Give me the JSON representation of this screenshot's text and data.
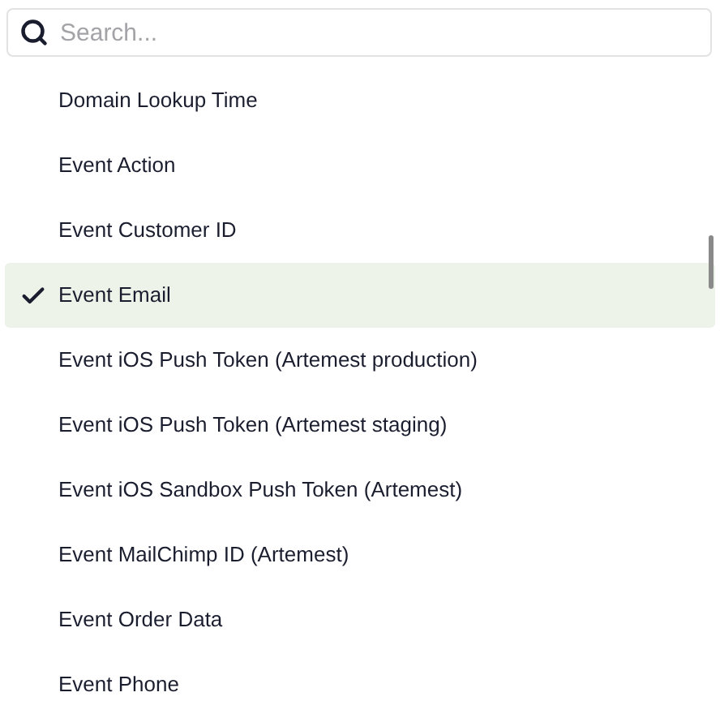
{
  "search": {
    "placeholder": "Search..."
  },
  "options": [
    {
      "label": "Domain Lookup Time",
      "selected": false
    },
    {
      "label": "Event Action",
      "selected": false
    },
    {
      "label": "Event Customer ID",
      "selected": false
    },
    {
      "label": "Event Email",
      "selected": true
    },
    {
      "label": "Event iOS Push Token (Artemest production)",
      "selected": false
    },
    {
      "label": "Event iOS Push Token (Artemest staging)",
      "selected": false
    },
    {
      "label": "Event iOS Sandbox Push Token (Artemest)",
      "selected": false
    },
    {
      "label": "Event MailChimp ID (Artemest)",
      "selected": false
    },
    {
      "label": "Event Order Data",
      "selected": false
    },
    {
      "label": "Event Phone",
      "selected": false
    }
  ]
}
